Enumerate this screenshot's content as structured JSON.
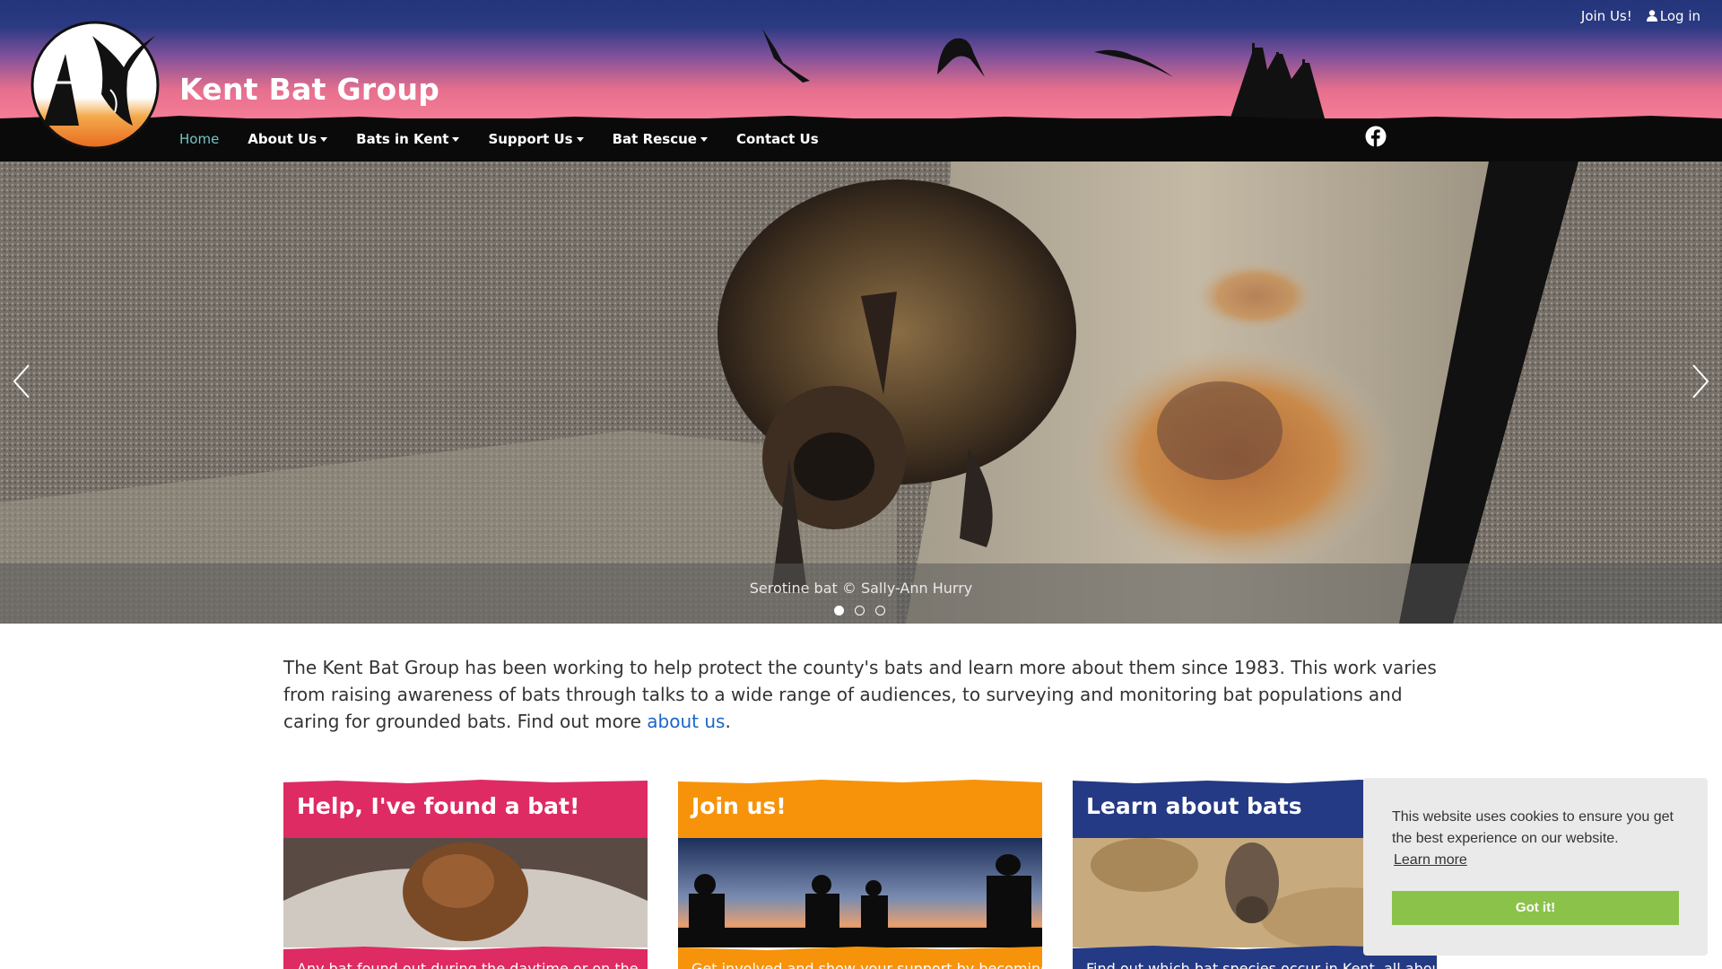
{
  "header": {
    "site_title": "Kent Bat Group",
    "top_links": [
      {
        "label": "Join Us!",
        "icon": ""
      },
      {
        "label": "Log in",
        "icon": "user-icon"
      }
    ],
    "nav": [
      {
        "label": "Home",
        "active": true,
        "dropdown": false
      },
      {
        "label": "About Us",
        "active": false,
        "dropdown": true
      },
      {
        "label": "Bats in Kent",
        "active": false,
        "dropdown": true
      },
      {
        "label": "Support Us",
        "active": false,
        "dropdown": true
      },
      {
        "label": "Bat Rescue",
        "active": false,
        "dropdown": true
      },
      {
        "label": "Contact Us",
        "active": false,
        "dropdown": false
      }
    ],
    "social_icon": "facebook-icon",
    "colors": {
      "sky_top": "#24357a",
      "sky_bottom": "#f58ea0",
      "nav_bg": "#0a0a0a",
      "active_nav": "#6fc7c6"
    }
  },
  "carousel": {
    "caption": "Serotine bat © Sally-Ann Hurry",
    "slide_count": 3,
    "active_slide": 1,
    "prev_icon": "chevron-left-icon",
    "next_icon": "chevron-right-icon"
  },
  "intro": {
    "text_before_link": "The Kent Bat Group has been working to help protect the county's bats and learn more about them since 1983. This work varies from raising awareness of bats through talks to a wide range of audiences, to surveying and monitoring bat populations and caring for grounded bats.  Find out more ",
    "link_text": "about us",
    "text_after_link": "."
  },
  "cards": [
    {
      "title": "Help, I've found a bat!",
      "text": "Any bat found out during the daytime or on the",
      "color": "#de2b63"
    },
    {
      "title": "Join us!",
      "text": "Get involved and show your support by becoming",
      "color": "#f7930a"
    },
    {
      "title": "Learn about bats",
      "text": "Find out which bat species occur in Kent, all about",
      "color": "#253a85"
    }
  ],
  "cookie": {
    "message": "This website uses cookies to ensure you get the best experience on our website.",
    "learn_more": "Learn more",
    "button": "Got it!",
    "button_color": "#8bc34a"
  }
}
